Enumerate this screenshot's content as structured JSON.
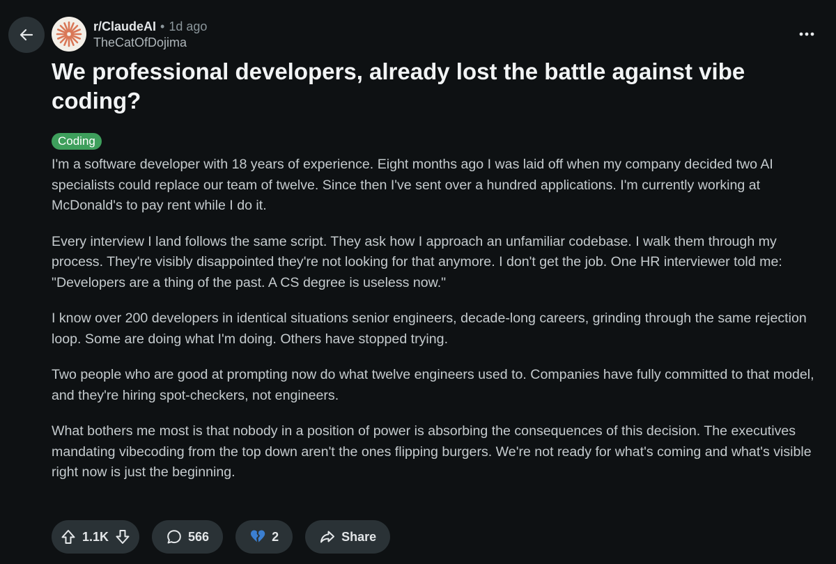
{
  "post": {
    "subreddit": "r/ClaudeAI",
    "separator": "•",
    "age": "1d ago",
    "author": "TheCatOfDojima",
    "title": "We professional developers, already lost the battle against vibe coding?",
    "flair": "Coding",
    "paragraphs": [
      "I'm a software developer with 18 years of experience. Eight months ago I was laid off when my company decided two AI specialists could replace our team of twelve. Since then I've sent over a hundred applications. I'm currently working at McDonald's to pay rent while I do it.",
      "Every interview I land follows the same script. They ask how I approach an unfamiliar codebase. I walk them through my process. They're visibly disappointed they're not looking for that anymore. I don't get the job. One HR interviewer told me: \"Developers are a thing of the past. A CS degree is useless now.\"",
      "I know over 200 developers in identical situations senior engineers, decade-long careers, grinding through the same rejection loop. Some are doing what I'm doing. Others have stopped trying.",
      "Two people who are good at prompting now do what twelve engineers used to. Companies have fully committed to that model, and they're hiring spot-checkers, not engineers.",
      "What bothers me most is that nobody in a position of power is absorbing the consequences of this decision. The executives mandating vibecoding from the top down aren't the ones flipping burgers. We're not ready for what's coming and what's visible right now is just the beginning."
    ]
  },
  "actions": {
    "votes": "1.1K",
    "comments": "566",
    "awards": "2",
    "share_label": "Share"
  },
  "icons": {
    "back": "arrow-left-icon",
    "more": "ellipsis-horizontal-icon",
    "upvote": "arrow-up-icon",
    "downvote": "arrow-down-icon",
    "comment": "speech-bubble-icon",
    "award": "broken-heart-icon",
    "share": "share-arrow-icon",
    "avatar": "claude-starburst-logo"
  },
  "colors": {
    "background": "#0e1113",
    "pill": "#2a3236",
    "flair": "#3e9f5c",
    "avatar_mark": "#d97757",
    "award_heart": "#3b7fd1"
  }
}
